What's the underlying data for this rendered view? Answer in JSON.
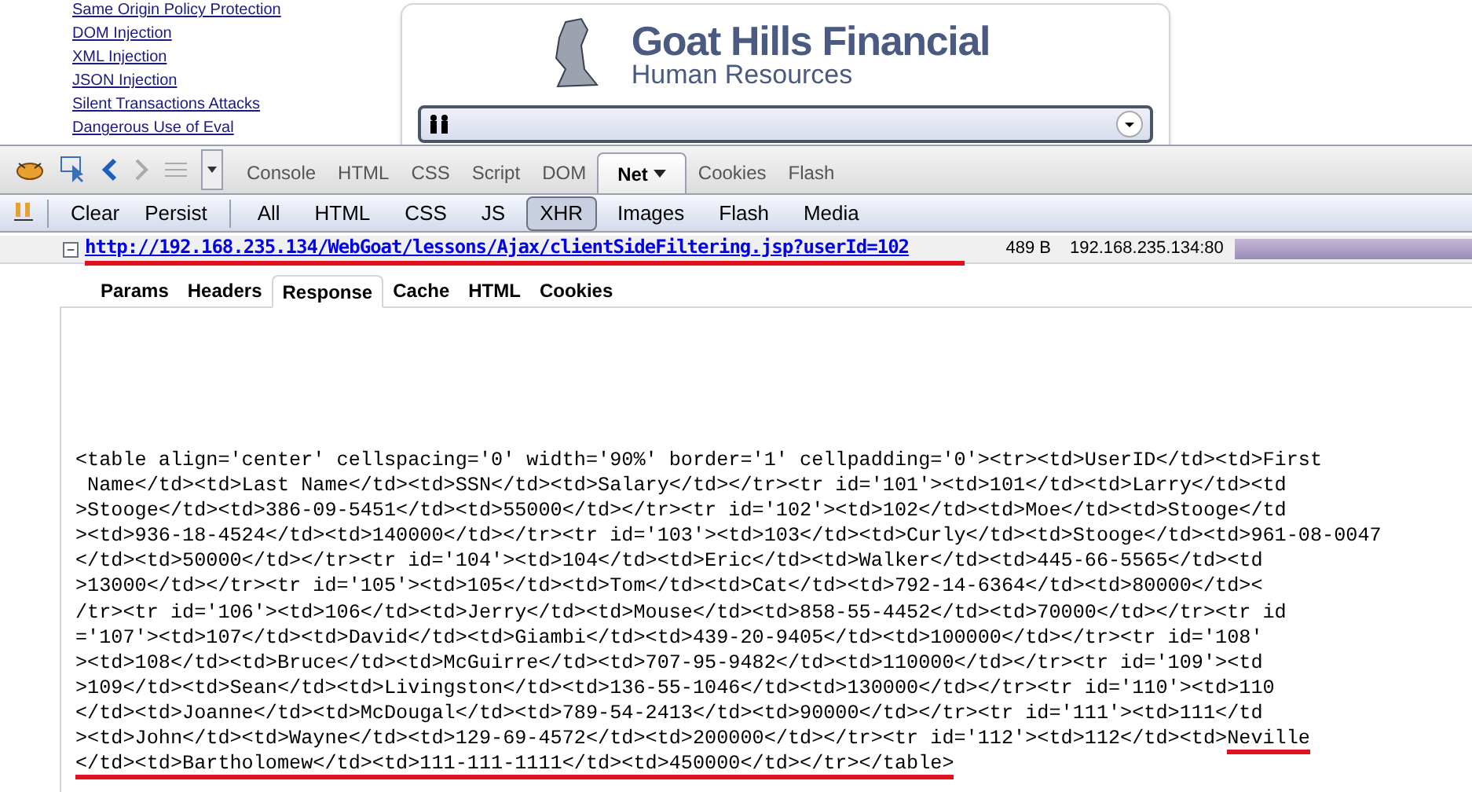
{
  "page": {
    "links": [
      "Same Origin Policy Protection",
      "DOM Injection",
      "XML Injection",
      "JSON Injection",
      "Silent Transactions Attacks",
      "Dangerous Use of Eval"
    ],
    "header": {
      "title": "Goat Hills Financial",
      "subtitle": "Human Resources"
    }
  },
  "firebug": {
    "tabs": [
      {
        "label": "Console",
        "selected": false,
        "menu": false
      },
      {
        "label": "HTML",
        "selected": false,
        "menu": false
      },
      {
        "label": "CSS",
        "selected": false,
        "menu": false
      },
      {
        "label": "Script",
        "selected": false,
        "menu": false
      },
      {
        "label": "DOM",
        "selected": false,
        "menu": false
      },
      {
        "label": "Net",
        "selected": true,
        "menu": true
      },
      {
        "label": "Cookies",
        "selected": false,
        "menu": false
      },
      {
        "label": "Flash",
        "selected": false,
        "menu": false
      }
    ],
    "actions": [
      "Clear",
      "Persist"
    ],
    "filters": [
      {
        "label": "All",
        "selected": false
      },
      {
        "label": "HTML",
        "selected": false
      },
      {
        "label": "CSS",
        "selected": false
      },
      {
        "label": "JS",
        "selected": false
      },
      {
        "label": "XHR",
        "selected": true
      },
      {
        "label": "Images",
        "selected": false
      },
      {
        "label": "Flash",
        "selected": false
      },
      {
        "label": "Media",
        "selected": false
      }
    ],
    "request": {
      "toggle": "−",
      "url": "http://192.168.235.134/WebGoat/lessons/Ajax/clientSideFiltering.jsp?userId=102",
      "marked": true,
      "size": "489 B",
      "remote": "192.168.235.134:80"
    },
    "subtabs": [
      {
        "label": "Params",
        "selected": false
      },
      {
        "label": "Headers",
        "selected": false
      },
      {
        "label": "Response",
        "selected": true
      },
      {
        "label": "Cache",
        "selected": false
      },
      {
        "label": "HTML",
        "selected": false
      },
      {
        "label": "Cookies",
        "selected": false
      }
    ],
    "response": [
      [
        {
          "text": "<table align='center' cellspacing='0' width='90%' border='1' cellpadding='0'><tr><td>UserID</td><td>First",
          "marked": false
        }
      ],
      [
        {
          "text": " Name</td><td>Last Name</td><td>SSN</td><td>Salary</td></tr><tr id='101'><td>101</td><td>Larry</td><td",
          "marked": false
        }
      ],
      [
        {
          "text": ">Stooge</td><td>386-09-5451</td><td>55000</td></tr><tr id='102'><td>102</td><td>Moe</td><td>Stooge</td",
          "marked": false
        }
      ],
      [
        {
          "text": "><td>936-18-4524</td><td>140000</td></tr><tr id='103'><td>103</td><td>Curly</td><td>Stooge</td><td>961-08-0047",
          "marked": false
        }
      ],
      [
        {
          "text": "</td><td>50000</td></tr><tr id='104'><td>104</td><td>Eric</td><td>Walker</td><td>445-66-5565</td><td",
          "marked": false
        }
      ],
      [
        {
          "text": ">13000</td></tr><tr id='105'><td>105</td><td>Tom</td><td>Cat</td><td>792-14-6364</td><td>80000</td><",
          "marked": false
        }
      ],
      [
        {
          "text": "/tr><tr id='106'><td>106</td><td>Jerry</td><td>Mouse</td><td>858-55-4452</td><td>70000</td></tr><tr id",
          "marked": false
        }
      ],
      [
        {
          "text": "='107'><td>107</td><td>David</td><td>Giambi</td><td>439-20-9405</td><td>100000</td></tr><tr id='108'",
          "marked": false
        }
      ],
      [
        {
          "text": "><td>108</td><td>Bruce</td><td>McGuirre</td><td>707-95-9482</td><td>110000</td></tr><tr id='109'><td",
          "marked": false
        }
      ],
      [
        {
          "text": ">109</td><td>Sean</td><td>Livingston</td><td>136-55-1046</td><td>130000</td></tr><tr id='110'><td>110",
          "marked": false
        }
      ],
      [
        {
          "text": "</td><td>Joanne</td><td>McDougal</td><td>789-54-2413</td><td>90000</td></tr><tr id='111'><td>111</td",
          "marked": false
        }
      ],
      [
        {
          "text": "><td>John</td><td>Wayne</td><td>129-69-4572</td><td>200000</td></tr><tr id='112'><td>112</td><td>",
          "marked": false
        },
        {
          "text": "Neville",
          "marked": true
        }
      ],
      [
        {
          "text": "</td><td>Bartholomew</td><td>111-111-1111</td><td>450000</td></tr></table>",
          "marked": true
        }
      ]
    ]
  }
}
